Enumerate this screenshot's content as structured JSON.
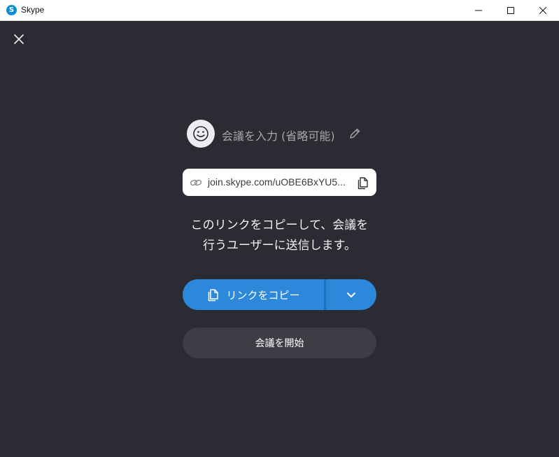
{
  "window": {
    "title": "Skype",
    "icon": "skype-logo-icon",
    "icon_glyph": "S",
    "controls": [
      "minimize-icon",
      "maximize-icon",
      "close-icon"
    ]
  },
  "dialog": {
    "close_icon": "close-icon",
    "avatar_icon": "smiley-icon",
    "meeting_name_placeholder": "会議を入力 (省略可能)",
    "edit_icon": "pencil-icon",
    "link": {
      "icon": "link-icon",
      "text": "join.skype.com/uOBE6BxYU5...",
      "copy_icon": "copy-icon"
    },
    "description_line1": "このリンクをコピーして、会議を",
    "description_line2": "行うユーザーに送信します。",
    "copy_button": {
      "label": "リンクをコピー",
      "icon": "copy-icon",
      "dropdown_icon": "chevron-down-icon"
    },
    "start_button": {
      "label": "会議を開始"
    }
  },
  "colors": {
    "background": "#2a2b33",
    "primary_button": "#2d88db",
    "secondary_button": "#3c3d45",
    "text_light": "#f3f3f5",
    "placeholder_text": "#a7a8ad"
  }
}
